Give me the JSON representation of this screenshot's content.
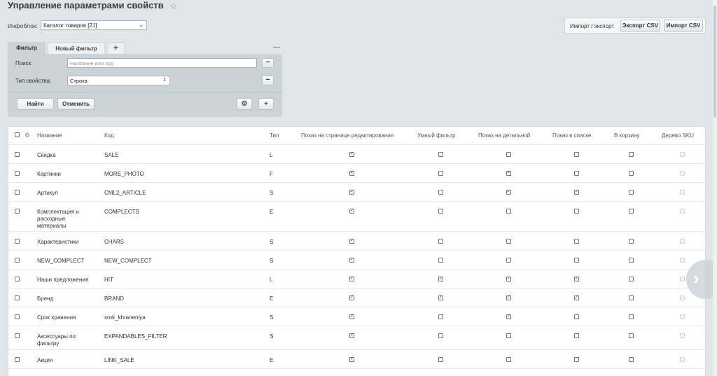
{
  "page": {
    "title": "Управление параметрами свойств",
    "star_icon": "star-icon"
  },
  "infoblock": {
    "label": "Инфоблок:",
    "selected": "Каталог товаров [21]"
  },
  "import_export": {
    "label": "Импорт / экспорт",
    "export_csv": "Экспорт CSV",
    "import_csv": "Импорт CSV"
  },
  "filter": {
    "tabs": [
      "Фильтр",
      "Новый фильтр"
    ],
    "add_tab": "+",
    "collapse": "—",
    "search_label": "Поиск:",
    "search_placeholder": "Название или код",
    "type_label": "Тип свойства:",
    "type_value": "Строка",
    "remove": "−",
    "find_button": "Найти",
    "cancel_button": "Отменить",
    "gear_icon": "gear-icon",
    "add_field": "+"
  },
  "table": {
    "columns": [
      "Название",
      "Код",
      "Тип",
      "Показ на странице редактирования",
      "Умный фильтр",
      "Показ на детальной",
      "Показ в списке",
      "В корзину",
      "Дерево SKU"
    ],
    "rows": [
      {
        "name": [
          "Скидка"
        ],
        "code": "SALE",
        "type": "L",
        "flags": [
          true,
          false,
          false,
          false,
          false,
          false
        ]
      },
      {
        "name": [
          "Картинки"
        ],
        "code": "MORE_PHOTO",
        "type": "F",
        "flags": [
          true,
          false,
          true,
          false,
          false,
          false
        ]
      },
      {
        "name": [
          "Артикул"
        ],
        "code": "CML2_ARTICLE",
        "type": "S",
        "flags": [
          true,
          false,
          true,
          true,
          false,
          false
        ]
      },
      {
        "name": [
          "Комплектация и",
          "расходные",
          "материалы"
        ],
        "code": "COMPLECTS",
        "type": "E",
        "flags": [
          true,
          false,
          false,
          false,
          false,
          false
        ]
      },
      {
        "name": [
          "Характеристики"
        ],
        "code": "CHARS",
        "type": "S",
        "flags": [
          true,
          false,
          false,
          false,
          false,
          false
        ]
      },
      {
        "name": [
          "NEW_COMPLECT"
        ],
        "code": "NEW_COMPLECT",
        "type": "S",
        "flags": [
          true,
          false,
          false,
          false,
          false,
          false
        ]
      },
      {
        "name": [
          "Наши предложения"
        ],
        "code": "HIT",
        "type": "L",
        "flags": [
          true,
          true,
          true,
          true,
          false,
          false
        ]
      },
      {
        "name": [
          "Бренд"
        ],
        "code": "BRAND",
        "type": "E",
        "flags": [
          true,
          true,
          true,
          true,
          false,
          false
        ]
      },
      {
        "name": [
          "Срок хранения"
        ],
        "code": "srok_khraneniya",
        "type": "S",
        "flags": [
          true,
          false,
          true,
          false,
          false,
          false
        ]
      },
      {
        "name": [
          "Аксессуары по",
          "фильтру"
        ],
        "code": "EXPANDABLES_FILTER",
        "type": "S",
        "flags": [
          true,
          false,
          false,
          false,
          false,
          false
        ]
      },
      {
        "name": [
          "Акция"
        ],
        "code": "LINK_SALE",
        "type": "E",
        "flags": [
          true,
          false,
          false,
          false,
          false,
          false
        ]
      }
    ]
  },
  "nav": {
    "next_icon": "chevron-right-icon"
  }
}
